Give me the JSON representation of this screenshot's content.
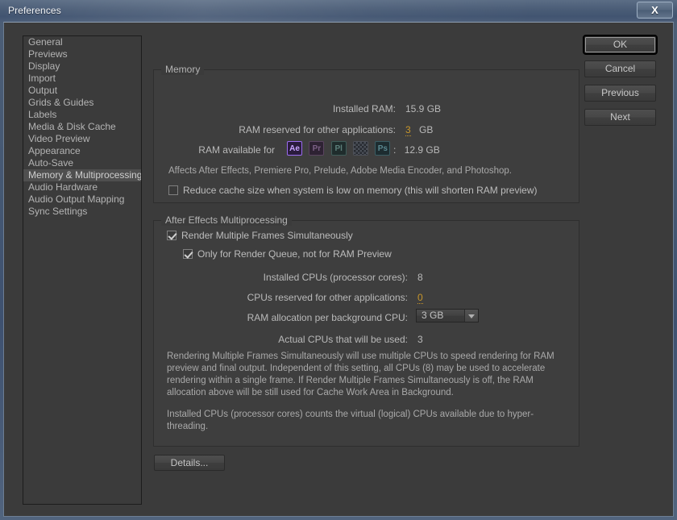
{
  "window": {
    "title": "Preferences",
    "close_label": "X"
  },
  "sidebar": {
    "items": [
      {
        "label": "General",
        "selected": false
      },
      {
        "label": "Previews",
        "selected": false
      },
      {
        "label": "Display",
        "selected": false
      },
      {
        "label": "Import",
        "selected": false
      },
      {
        "label": "Output",
        "selected": false
      },
      {
        "label": "Grids & Guides",
        "selected": false
      },
      {
        "label": "Labels",
        "selected": false
      },
      {
        "label": "Media & Disk Cache",
        "selected": false
      },
      {
        "label": "Video Preview",
        "selected": false
      },
      {
        "label": "Appearance",
        "selected": false
      },
      {
        "label": "Auto-Save",
        "selected": false
      },
      {
        "label": "Memory & Multiprocessing",
        "selected": true
      },
      {
        "label": "Audio Hardware",
        "selected": false
      },
      {
        "label": "Audio Output Mapping",
        "selected": false
      },
      {
        "label": "Sync Settings",
        "selected": false
      }
    ]
  },
  "buttons": {
    "ok": "OK",
    "cancel": "Cancel",
    "previous": "Previous",
    "next": "Next",
    "details": "Details..."
  },
  "memory": {
    "group_title": "Memory",
    "installed_ram_label": "Installed RAM:",
    "installed_ram_value": "15.9 GB",
    "reserved_ram_label": "RAM reserved for other applications:",
    "reserved_ram_value": "3",
    "reserved_ram_unit": "GB",
    "available_label": "RAM available for",
    "available_separator": ":",
    "available_value": "12.9 GB",
    "apps": [
      {
        "name": "after-effects",
        "glyph": "Ae",
        "active": true
      },
      {
        "name": "premiere-pro",
        "glyph": "Pr",
        "active": false
      },
      {
        "name": "prelude",
        "glyph": "Pl",
        "active": false
      },
      {
        "name": "adobe-media-encoder",
        "glyph": "",
        "active": false
      },
      {
        "name": "photoshop",
        "glyph": "Ps",
        "active": false
      }
    ],
    "affects_note": "Affects After Effects, Premiere Pro, Prelude, Adobe Media Encoder, and Photoshop.",
    "reduce_cache_label": "Reduce cache size when system is low on memory (this will shorten RAM preview)",
    "reduce_cache_checked": false
  },
  "multiprocessing": {
    "group_title": "After Effects Multiprocessing",
    "render_mfs_label": "Render Multiple Frames Simultaneously",
    "render_mfs_checked": true,
    "only_render_queue_label": "Only for Render Queue, not for RAM Preview",
    "only_render_queue_checked": true,
    "installed_cpus_label": "Installed CPUs (processor cores):",
    "installed_cpus_value": "8",
    "reserved_cpus_label": "CPUs reserved for other applications:",
    "reserved_cpus_value": "0",
    "ram_alloc_label": "RAM allocation per background CPU:",
    "ram_alloc_value": "3 GB",
    "actual_cpus_label": "Actual CPUs that will be used:",
    "actual_cpus_value": "3",
    "paragraph_1": "Rendering Multiple Frames Simultaneously will use multiple CPUs to speed rendering for RAM preview and final output. Independent of this setting, all CPUs (8) may be used to accelerate rendering within a single frame. If Render Multiple Frames Simultaneously is off, the RAM allocation above will be still used for Cache Work Area in Background.",
    "paragraph_2": "Installed CPUs (processor cores) counts the virtual (logical) CPUs available due to hyper-threading."
  },
  "colors": {
    "dialog_bg": "#3b3b3b",
    "group_bg": "#3e3e3e",
    "text": "#b9b9b9",
    "hot_text": "#c8962a",
    "titlebar": "#4a5c76",
    "selection": "#4f4f4f"
  }
}
